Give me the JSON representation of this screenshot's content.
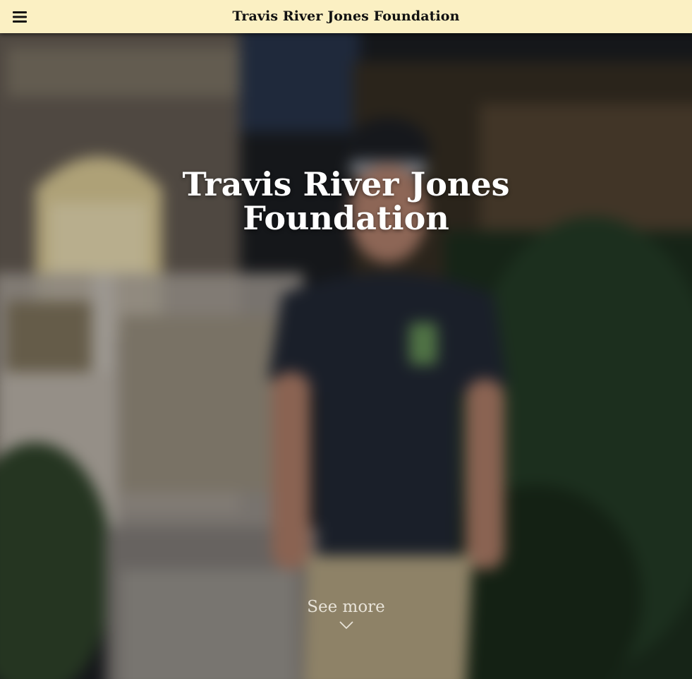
{
  "header": {
    "title": "Travis River Jones Foundation",
    "menu_icon": "hamburger-menu-icon",
    "background_color": "#fbf0c3"
  },
  "hero": {
    "title_line1": "Travis River Jones",
    "title_line2": "Foundation",
    "see_more_label": "See more",
    "see_more_icon": "chevron-down-icon"
  }
}
